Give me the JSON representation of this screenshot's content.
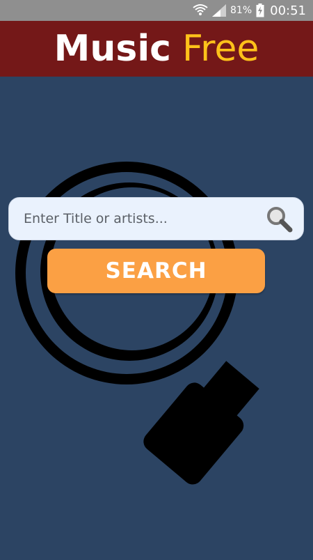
{
  "status_bar": {
    "battery_percent": "81%",
    "time": "00:51",
    "icons": [
      "wifi-icon",
      "signal-icon",
      "battery-charging-icon"
    ]
  },
  "header": {
    "title_part1": "Music",
    "title_part2": "Free",
    "colors": {
      "background": "#741818",
      "part1": "#ffffff",
      "part2": "#ffc21a"
    }
  },
  "search": {
    "placeholder": "Enter Title or artists...",
    "value": "",
    "icon": "magnifier-icon",
    "button_label": "SEARCH"
  },
  "colors": {
    "page_background": "#2c4463",
    "button": "#fba044"
  }
}
